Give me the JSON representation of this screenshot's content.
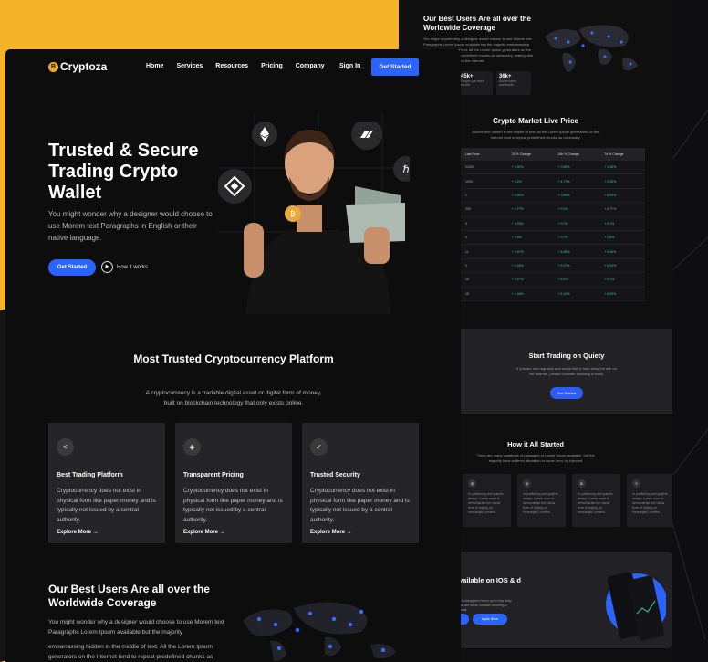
{
  "colors": {
    "accent": "#2b63ff",
    "background": "#0d0d0e",
    "gold": "#f5b32a",
    "card": "#252527"
  },
  "back_page": {
    "coverage_title": "Our Best Users Are all over the Worldwide Coverage",
    "coverage_text": "You might wonder why a designer would choose to use Morem text Paragraphs Lorem Ipsum available but the majority embarrassing hidden in the middle of text. All the Lorem Ipsum generators on the Internet tend to repeat predefined chunks as necessary, making this the first true generator on the Internet.",
    "stats": [
      {
        "value": "45k+",
        "label": "People join each month"
      },
      {
        "value": "36k+",
        "label": "Active users worldwide"
      }
    ],
    "market_title": "Crypto Market Live Price",
    "market_text": "Morem text hidden in the middle of text. All the Lorem Ipsum generators on the Internet tend to repeat predefined chunks as necessary.",
    "table_headers": [
      "Last Price",
      "24 % Change",
      "24h % Change",
      "7d % Change"
    ],
    "table_rows": [
      [
        "22000",
        "+ 0.01%",
        "+ 0.05%",
        "+ 1.05%"
      ],
      [
        "1000",
        "+ 0.2%",
        "+ 4.77%",
        "+ 0.05%"
      ],
      [
        "1",
        "+ 0.01%",
        "+ 0.05%",
        "+ 6.09%"
      ],
      [
        "200",
        "+ 2.77%",
        "+ 0.1%",
        "+ 4.77%"
      ],
      [
        "0",
        "+ 0.03%",
        "+ 0.7%",
        "+ 0.1%"
      ],
      [
        "0",
        "+ 0.3%",
        "+ 0.7%",
        "+ 2.6%"
      ],
      [
        "11",
        "+ 0.07%",
        "+ 6.08%",
        "+ 0.05%"
      ],
      [
        "0",
        "+ 1.04%",
        "+ 2.07%",
        "+ 0.03%"
      ],
      [
        "15",
        "+ 0.27%",
        "+ 6.1%",
        "+ 0.1%"
      ],
      [
        "15",
        "+ 1.04%",
        "+ 6.10%",
        "+ 0.03%"
      ]
    ],
    "start_title": "Start Trading on Quiety",
    "start_text": "If you are into regularly and would like to help keep the site on the Internet, please consider donating a small.",
    "start_button": "Get Started",
    "how_title": "How it All Started",
    "how_text": "There are many variations of passages of Lorem Ipsum available, but the majority have suffered alteration in some form, by injected",
    "how_cards": [
      "In publishing and graphic design, Lorem used to demonstrate the visual form of relying on meaningful content.",
      "In publishing and graphic design, Lorem used to demonstrate the visual form of relying on meaningful content.",
      "In publishing and graphic design, Lorem used to demonstrate the visual form of relying on meaningful content.",
      "In publishing and graphic design, Lorem used to demonstrate the visual form of relying on meaningful content."
    ],
    "app_title": "vailable on IOS & d",
    "app_text": "d is simply text lorem up to help keep the site on an consider donating a small.",
    "app_store": "Apple Store"
  },
  "nav": {
    "logo": "Cryptoza",
    "logo_mark": "B",
    "items": [
      "Home",
      "Services",
      "Resources",
      "Pricing",
      "Company"
    ],
    "sign_in": "Sign In",
    "cta": "Get Started"
  },
  "hero": {
    "title": "Trusted & Secure Trading Crypto Wallet",
    "description": "You might wonder why a designer would choose to use Morem text Paragraphs in English or their native language.",
    "cta": "Get Started",
    "how_it_works": "How it works"
  },
  "trusted": {
    "title": "Most Trusted Cryptocurrency Platform",
    "description": "A cryptocurrency is a tradable digital asset or digital form of money, built on blockchain technology that only exists online."
  },
  "features": [
    {
      "icon": "share-icon",
      "glyph": "<",
      "title": "Best Trading Platform",
      "text": "Cryptocurrency does not exist in physical form like paper money and is typically not issued by a central authority.",
      "link": "Explore More →"
    },
    {
      "icon": "tag-icon",
      "glyph": "◈",
      "title": "Transparent Pricing",
      "text": "Cryptocurrency does not exist in physical form like paper money and is typically not issued by a central authority.",
      "link": "Explore More →"
    },
    {
      "icon": "shield-icon",
      "glyph": "✓",
      "title": "Trusted Security",
      "text": "Cryptocurrency does not exist in physical form like paper money and is typically not issued by a central authority.",
      "link": "Explore More →"
    }
  ],
  "coverage": {
    "title": "Our Best Users Are all over the Worldwide Coverage",
    "text": "You might wonder why a designer would choose to use Morem text Paragraphs Lorem Ipsum available but the majority",
    "text2": "embarrassing hidden in the middle of text. All the Lorem Ipsum generators on the Internet tend to repeat predefined chunks as"
  }
}
